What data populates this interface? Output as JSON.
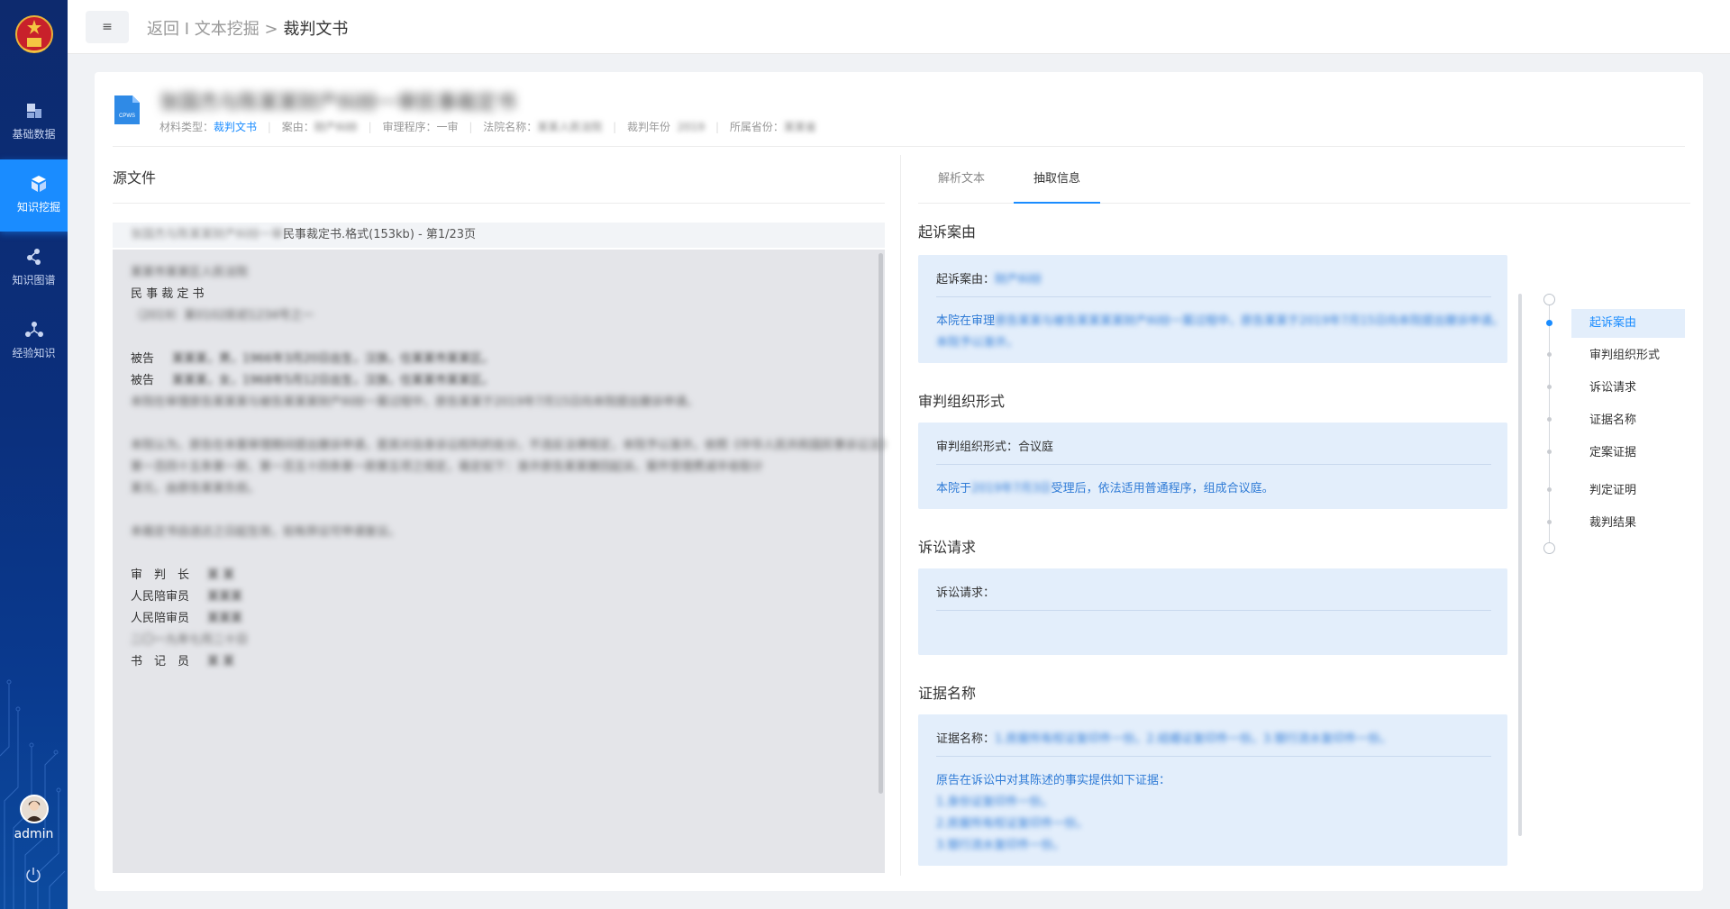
{
  "sidebar": {
    "items": [
      {
        "label": "基础数据",
        "icon": "database-icon"
      },
      {
        "label": "知识挖掘",
        "icon": "mining-icon",
        "active": true
      },
      {
        "label": "知识图谱",
        "icon": "graph-icon"
      },
      {
        "label": "经验知识",
        "icon": "experience-icon"
      }
    ],
    "user": "admin"
  },
  "topbar": {
    "menu_glyph": "≡",
    "back": "返回",
    "sep": "I",
    "parent": "文本挖掘",
    "arrow": ">",
    "current": "裁判文书"
  },
  "doc": {
    "icon_label": "CPWS",
    "title": "张国杰与陈某某财产纠纷一审民事裁定书",
    "meta": {
      "type_label": "材料类型：",
      "type_value": "裁判文书",
      "cause_label": "案由：",
      "cause_value": "财产纠纷",
      "procedure_label": "审理程序：",
      "procedure_value": "一审",
      "court_label": "法院名称：",
      "court_value": "某某人民法院",
      "year_label": "裁判年份",
      "year_value": "2019",
      "province_label": "所属省份：",
      "province_value": "某某省"
    }
  },
  "left": {
    "title": "源文件",
    "file_prefix": "张国杰与陈某某财产纠纷一审",
    "file_name": "民事裁定书.格式(153kb) - 第1/23页",
    "lines": [
      {
        "text": "某某市某某区人民法院",
        "blur": true
      },
      {
        "text": "民 事 裁 定 书",
        "blur": false
      },
      {
        "text": "（2019）某0102民初1234号之一",
        "blur": true
      },
      {
        "text": "",
        "blur": false
      },
      {
        "text": "被告",
        "suffix": "某某某，男，1966年3月20日出生，汉族，住某某市某某区。",
        "blur": false
      },
      {
        "text": "被告",
        "suffix": "某某某，女，1968年5月12日出生，汉族，住某某市某某区。",
        "blur": false
      },
      {
        "text": "本院在审理原告某某某与被告某某某财产纠纷一案过程中，原告某某于2019年7月15日向本院提出撤诉申请。",
        "blur": true
      },
      {
        "text": "",
        "blur": false
      },
      {
        "text": "本院认为，原告在本案审理期间提出撤诉申请，是其对自身诉讼权利的处分，不违反法律规定，本院予以准许。依照《中华人民共和国民事诉讼法》",
        "blur": true
      },
      {
        "text": "第一百四十五条第一款、第一百五十四条第一款第五项之规定，裁定如下：准许原告某某撤回起诉。案件受理费减半收取计",
        "blur": true
      },
      {
        "text": "某元，由原告某某负担。",
        "blur": true
      },
      {
        "text": "",
        "blur": false
      },
      {
        "text": "本裁定书自送达之日起生效，如有异议可申请复议。",
        "blur": true
      },
      {
        "text": "",
        "blur": false
      },
      {
        "text": "审　判　长",
        "suffix": "某 某",
        "blur": false
      },
      {
        "text": "人民陪审员",
        "suffix": "某某某",
        "blur": false
      },
      {
        "text": "人民陪审员",
        "suffix": "某某某",
        "blur": false
      },
      {
        "text": "二〇一九年七月二十日",
        "blur": true
      },
      {
        "text": "书　记　员",
        "suffix": "某 某",
        "blur": false
      }
    ]
  },
  "right": {
    "tabs": [
      "解析文本",
      "抽取信息"
    ],
    "active_tab": 1,
    "sections": [
      {
        "title": "起诉案由",
        "label": "起诉案由：",
        "value": "财产纠纷",
        "desc_prefix": "本院在审理",
        "desc": "原告某某与被告某某某某财产纠纷一案过程中，原告某某于2019年7月15日向本院提出撤诉申请。",
        "desc2": "本院予以准许。"
      },
      {
        "title": "审判组织形式",
        "label": "审判组织形式：",
        "value": "合议庭",
        "desc_prefix": "本院于",
        "desc_blur": "2019年7月3日",
        "desc_suffix": "受理后，依法适用普通程序，组成合议庭。"
      },
      {
        "title": "诉讼请求",
        "label": "诉讼请求："
      },
      {
        "title": "证据名称",
        "label": "证据名称：",
        "value": "1.房屋所有权证复印件一份。2.结婚证复印件一份。3.银行流水复印件一份。",
        "desc": "原告在诉讼中对其陈述的事实提供如下证据：",
        "items": [
          "1.身份证复印件一份。",
          "2.房屋所有权证复印件一份。",
          "3.银行流水复印件一份。"
        ]
      }
    ],
    "outline": [
      "起诉案由",
      "审判组织形式",
      "诉讼请求",
      "证据名称",
      "定案证据",
      "判定证明",
      "裁判结果"
    ],
    "outline_active": 0
  },
  "colors": {
    "accent": "#1a8cff",
    "sidebar": "#0b2f7c",
    "box": "#e3eefb"
  }
}
